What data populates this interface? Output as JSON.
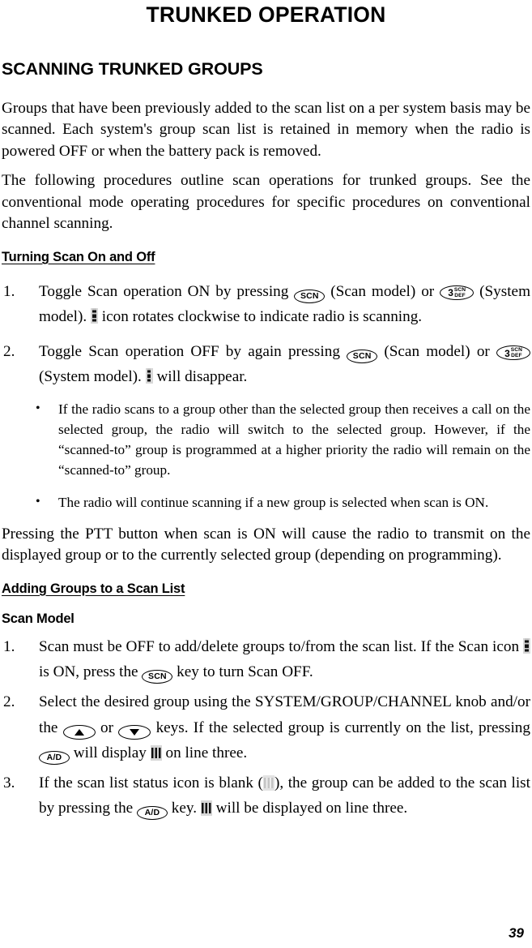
{
  "document": {
    "title": "TRUNKED OPERATION",
    "page_number": "39"
  },
  "sections": {
    "scanning_trunked_groups": {
      "heading": "SCANNING TRUNKED GROUPS",
      "paragraph_1": "Groups that have been previously added to the scan list on a per system basis may be scanned. Each system's group scan list is retained in memory when the radio is powered OFF or when the battery pack is removed.",
      "paragraph_2": "The following procedures outline scan operations for trunked groups. See the conventional mode operating procedures for specific procedures on conventional channel scanning."
    },
    "turning_scan_on_and_off": {
      "heading": "Turning Scan On and Off",
      "step_1": {
        "number": "1.",
        "part_a": "Toggle Scan operation ON by pressing",
        "part_b": "(Scan model) or",
        "part_c": "(System model).",
        "part_d": "icon rotates clockwise to indicate radio is scanning."
      },
      "step_2": {
        "number": "2.",
        "part_a": "Toggle Scan operation OFF by again pressing",
        "part_b": "(Scan model) or",
        "part_c": "(System model).",
        "part_d": "will disappear."
      },
      "bullets": [
        {
          "marker": "•",
          "text": "If the radio scans to a group other than the selected group then receives a call on the selected group, the radio will switch to the selected group.  However, if the “scanned-to” group is programmed at a higher priority the radio will remain on the “scanned-to” group."
        },
        {
          "marker": "•",
          "text": "The radio will continue scanning if a new group is selected when scan is ON."
        }
      ],
      "closing_paragraph": "Pressing the PTT button when scan is ON will cause the radio to transmit on the displayed group or to the currently selected group (depending on programming)."
    },
    "adding_groups_to_a_scan_list": {
      "heading": "Adding Groups to a Scan List",
      "subheading": "Scan Model",
      "step_1": {
        "number": "1.",
        "part_a": "Scan must be OFF to add/delete groups to/from the scan list. If the Scan icon",
        "part_b": "is ON, press the",
        "part_c": "key to turn Scan OFF."
      },
      "step_2": {
        "number": "2.",
        "part_a": "Select the desired group using the SYSTEM/GROUP/CHANNEL knob and/or the",
        "part_b": "or",
        "part_c": "keys. If the selected group is currently on the list, pressing",
        "part_d": "will display",
        "part_e": "on line three."
      },
      "step_3": {
        "number": "3.",
        "part_a": "If the scan list status icon is blank (",
        "part_b": "), the group can be added to the scan list by pressing the",
        "part_c": "key.",
        "part_d": "will be displayed on line three."
      }
    }
  },
  "keys": {
    "scn": "SCN",
    "ad": "A/D",
    "three_scn_def": {
      "digit": "3",
      "top": "SCN",
      "bottom": "DEF"
    },
    "up_arrow": "▲",
    "down_arrow": "▼"
  },
  "icons": {
    "scan_indicator": "scan-rotating-icon",
    "scan_list_full": "scan-list-full-icon",
    "scan_list_blank": "scan-list-blank-icon"
  },
  "colors": {
    "text": "#000000",
    "background": "#ffffff",
    "lcd_gray": "#d8d8d8",
    "lcd_blank_gray": "#e3e3e3"
  }
}
